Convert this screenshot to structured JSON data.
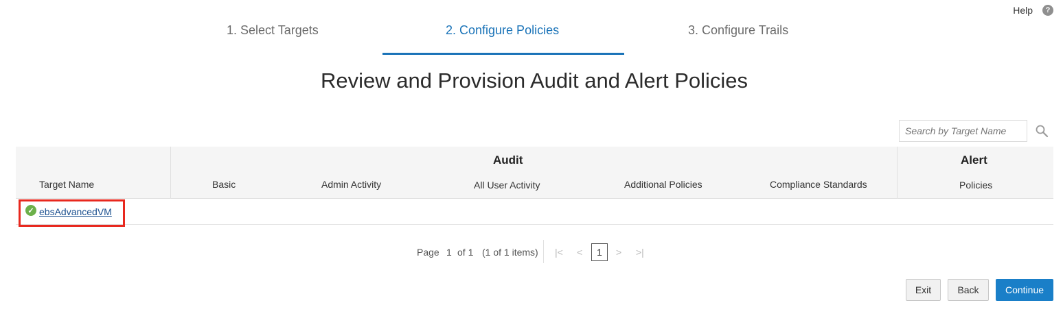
{
  "help": {
    "label": "Help",
    "icon": "question-circle-icon",
    "icon_glyph": "?"
  },
  "steps": [
    {
      "label": "1. Select Targets"
    },
    {
      "label": "2. Configure Policies",
      "active": true
    },
    {
      "label": "3. Configure Trails"
    }
  ],
  "title": "Review and Provision Audit and Alert Policies",
  "search": {
    "placeholder": "Search by Target Name",
    "value": ""
  },
  "table": {
    "group_headers": {
      "audit": "Audit",
      "alert": "Alert"
    },
    "columns": {
      "target_name": "Target Name",
      "basic": "Basic",
      "admin_activity": "Admin Activity",
      "all_user_activity": "All User Activity",
      "additional_policies": "Additional Policies",
      "compliance_standards": "Compliance Standards",
      "policies": "Policies"
    },
    "rows": [
      {
        "target_name": "ebsAdvancedVM",
        "status": "success",
        "status_icon": "check-circle-icon",
        "status_glyph": "✓"
      }
    ]
  },
  "pagination": {
    "page_label": "Page",
    "current_page": "1",
    "of_label": "of 1",
    "items_label": "(1 of 1 items)",
    "page_box": "1",
    "first_glyph": "|<",
    "prev_glyph": "<",
    "next_glyph": ">",
    "last_glyph": ">|"
  },
  "buttons": {
    "exit": "Exit",
    "back": "Back",
    "continue": "Continue"
  },
  "colors": {
    "accent": "#1a73b8",
    "primary_button": "#1a7fc8",
    "success": "#6cb04a",
    "highlight": "#e8281e"
  }
}
